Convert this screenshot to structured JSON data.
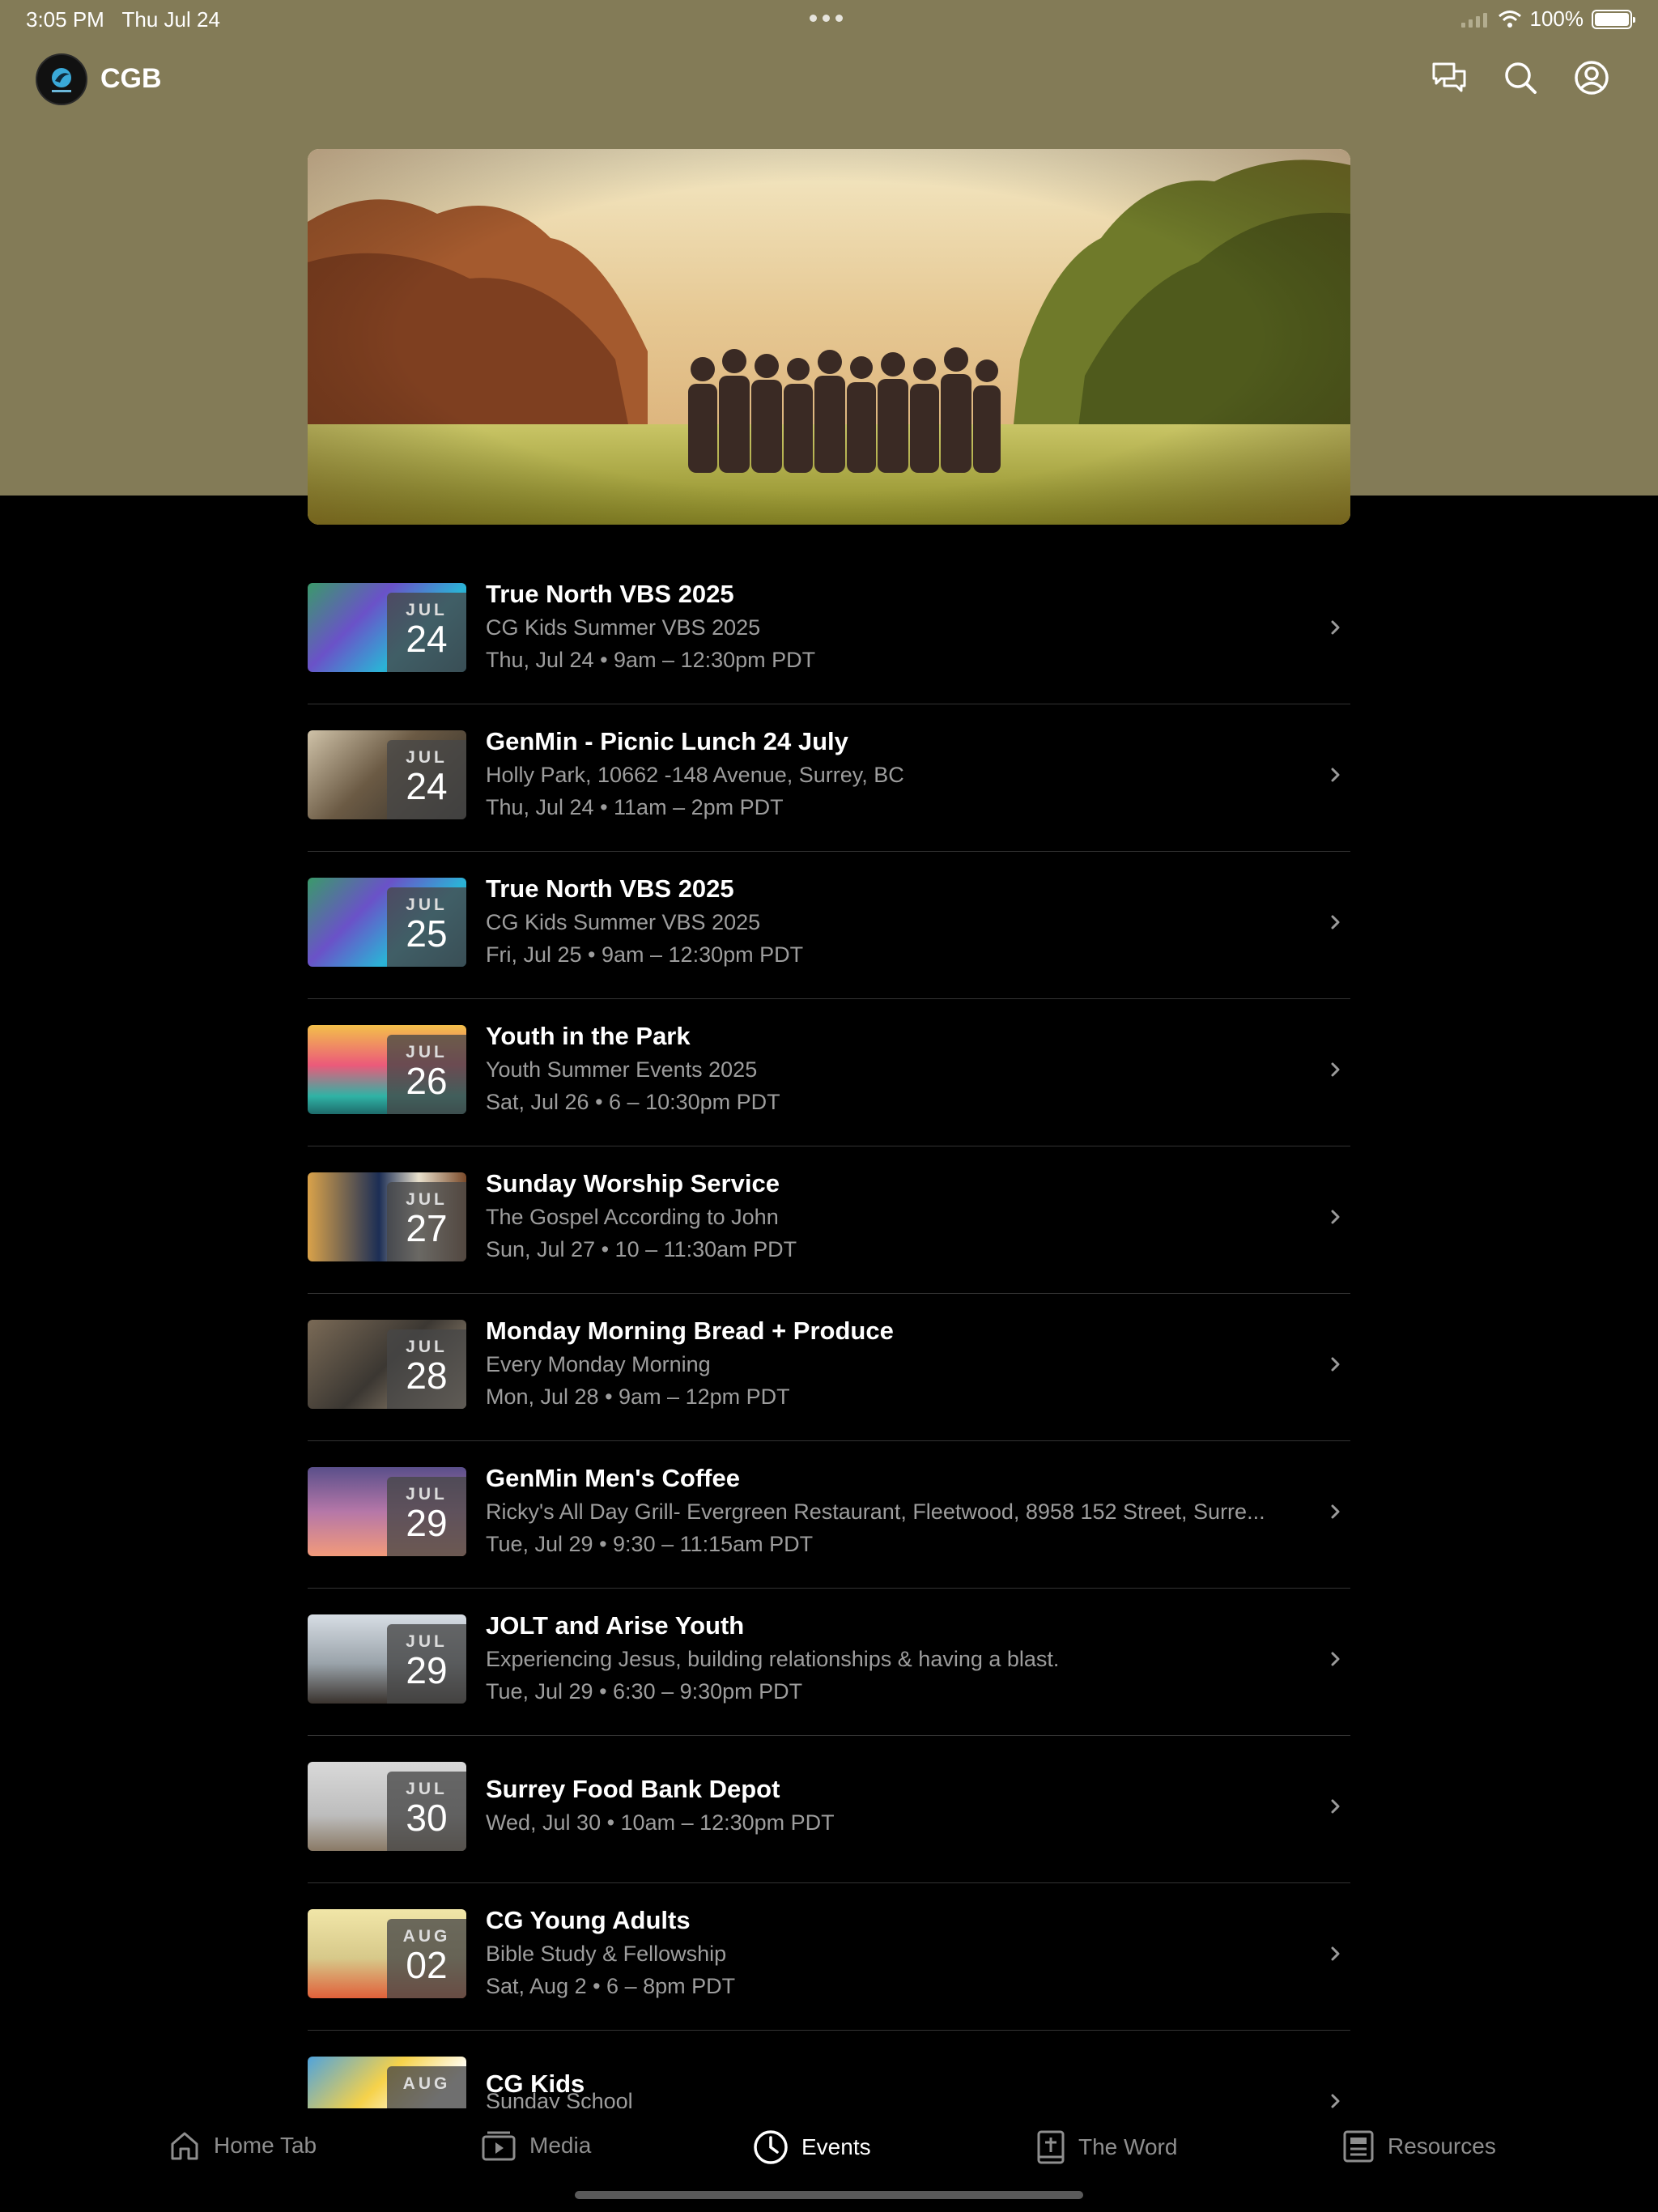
{
  "status_bar": {
    "time": "3:05 PM",
    "date": "Thu Jul 24",
    "battery": "100%",
    "battery_level": 1.0
  },
  "header": {
    "app_title": "CGB"
  },
  "events": [
    {
      "month": "JUL",
      "day": "24",
      "title": "True North VBS 2025",
      "subtitle": "CG Kids Summer VBS 2025",
      "time": "Thu, Jul 24 • 9am – 12:30pm PDT"
    },
    {
      "month": "JUL",
      "day": "24",
      "title": "GenMin  - Picnic Lunch 24 July",
      "subtitle": "Holly Park, 10662 -148 Avenue, Surrey, BC",
      "time": "Thu, Jul 24 • 11am – 2pm PDT"
    },
    {
      "month": "JUL",
      "day": "25",
      "title": "True North VBS 2025",
      "subtitle": "CG Kids Summer VBS 2025",
      "time": "Fri, Jul 25 • 9am – 12:30pm PDT"
    },
    {
      "month": "JUL",
      "day": "26",
      "title": "Youth in the Park",
      "subtitle": "Youth Summer Events 2025",
      "time": "Sat, Jul 26 • 6 – 10:30pm PDT"
    },
    {
      "month": "JUL",
      "day": "27",
      "title": "Sunday Worship Service",
      "subtitle": "The Gospel According to John",
      "time": "Sun, Jul 27 • 10 – 11:30am PDT"
    },
    {
      "month": "JUL",
      "day": "28",
      "title": "Monday Morning Bread + Produce",
      "subtitle": "Every Monday Morning",
      "time": "Mon, Jul 28 • 9am – 12pm PDT"
    },
    {
      "month": "JUL",
      "day": "29",
      "title": "GenMin Men's Coffee",
      "subtitle": "Ricky's All Day Grill- Evergreen Restaurant, Fleetwood, 8958 152 Street, Surre...",
      "time": "Tue, Jul 29 • 9:30 – 11:15am PDT"
    },
    {
      "month": "JUL",
      "day": "29",
      "title": "JOLT and Arise Youth",
      "subtitle": "Experiencing Jesus, building relationships & having a blast.",
      "time": "Tue, Jul 29 • 6:30 – 9:30pm PDT"
    },
    {
      "month": "JUL",
      "day": "30",
      "title": "Surrey Food Bank Depot",
      "subtitle": "",
      "time": "Wed, Jul 30 • 10am – 12:30pm PDT"
    },
    {
      "month": "AUG",
      "day": "02",
      "title": "CG Young Adults",
      "subtitle": "Bible Study & Fellowship",
      "time": "Sat, Aug 2 • 6 – 8pm PDT"
    },
    {
      "month": "AUG",
      "day": "",
      "title": "CG Kids",
      "subtitle": "Sunday School",
      "time": ""
    }
  ],
  "tabs": [
    {
      "label": "Home Tab",
      "icon": "home-icon"
    },
    {
      "label": "Media",
      "icon": "media-icon"
    },
    {
      "label": "Events",
      "icon": "clock-icon",
      "active": true
    },
    {
      "label": "The Word",
      "icon": "bible-icon"
    },
    {
      "label": "Resources",
      "icon": "document-icon"
    }
  ],
  "colors": {
    "header_background": "#837b57",
    "background": "#000000",
    "active_tab": "#ffffff",
    "inactive_tab": "#8e8e8e"
  }
}
